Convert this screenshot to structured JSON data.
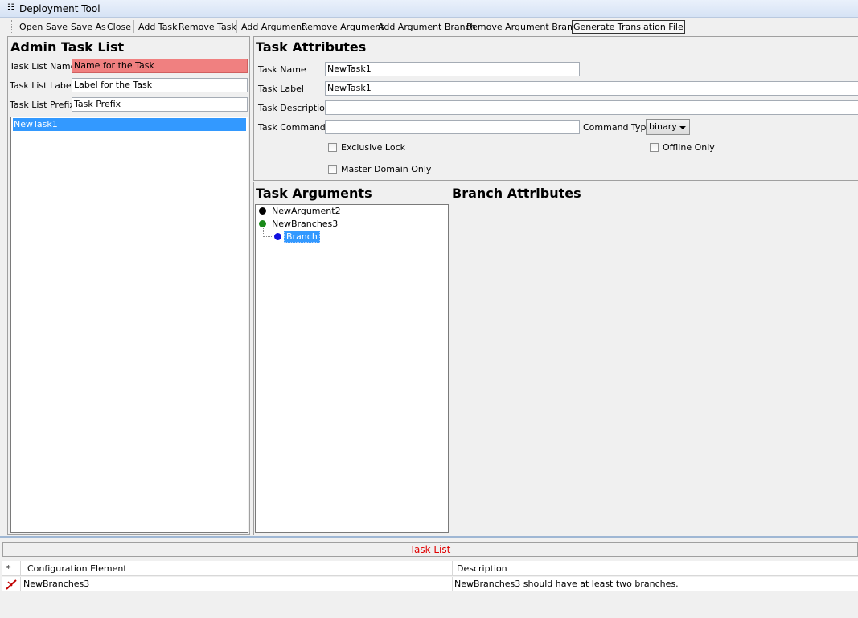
{
  "window": {
    "title": "Deployment Tool"
  },
  "toolbar": {
    "open": "Open",
    "save": "Save",
    "save_as": "Save As",
    "close": "Close",
    "add_task": "Add Task",
    "remove_task": "Remove Task",
    "add_argument": "Add Argument",
    "remove_argument": "Remove Argument",
    "add_argument_branch": "Add Argument Branch",
    "remove_argument_branch": "Remove Argument Branch",
    "generate_translation_file": "Generate Translation File"
  },
  "admin_task_list": {
    "heading": "Admin Task List",
    "name_label": "Task List Name",
    "name_value": "Name for the Task",
    "label_label": "Task List Label",
    "label_value": "Label for the Task",
    "prefix_label": "Task List Prefix",
    "prefix_value": "Task Prefix",
    "tasks": [
      "NewTask1"
    ]
  },
  "task_attributes": {
    "heading": "Task Attributes",
    "name_label": "Task Name",
    "name_value": "NewTask1",
    "label_label": "Task Label",
    "label_value": "NewTask1",
    "description_label": "Task Description",
    "description_value": "",
    "command_label": "Task Command",
    "command_value": "",
    "command_type_label": "Command Type",
    "command_type_value": "binary",
    "exclusive_lock": "Exclusive Lock",
    "offline_only": "Offline Only",
    "master_domain_only": "Master Domain Only"
  },
  "task_arguments": {
    "heading": "Task Arguments",
    "items": [
      {
        "label": "NewArgument2",
        "dot_color": "#000000"
      },
      {
        "label": "NewBranches3",
        "dot_color": "#1a8a1a"
      },
      {
        "label": "Branch",
        "dot_color": "#1010e0",
        "selected": true
      }
    ]
  },
  "branch_attributes": {
    "heading": "Branch Attributes"
  },
  "bottom": {
    "tab_label": "Task List",
    "col_star": "*",
    "col_config": "Configuration Element",
    "col_desc": "Description",
    "rows": [
      {
        "config": "NewBranches3",
        "desc": "NewBranches3 should have at least two branches."
      }
    ]
  },
  "colors": {
    "selection": "#3399ff",
    "error_field": "#f08080",
    "tab_text": "#e00000"
  }
}
